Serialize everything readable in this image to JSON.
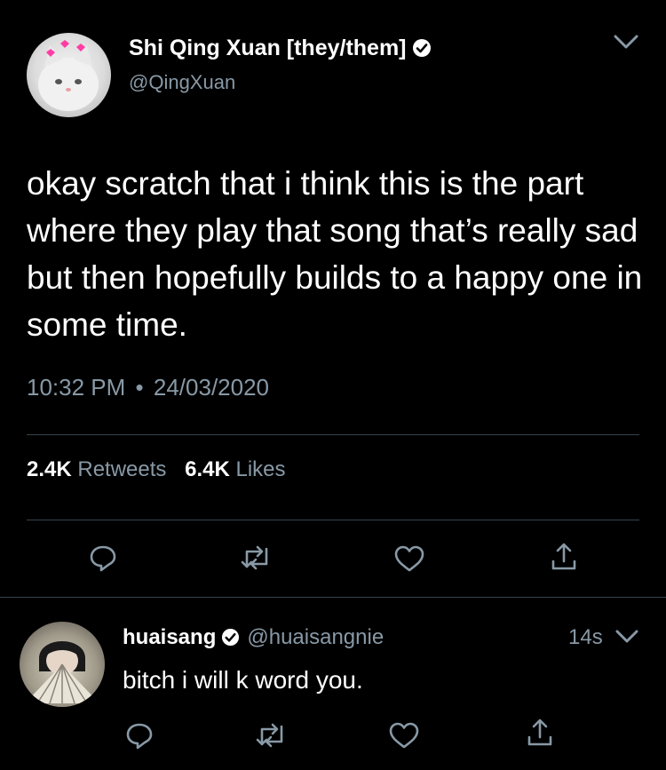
{
  "tweet": {
    "author_name": "Shi Qing Xuan [they/them]",
    "author_handle": "@QingXuan",
    "text": "okay scratch that i think this is the part where they play that song that’s really sad but then hopefully builds to a happy one in some time.",
    "time": "10:32 PM",
    "separator": "•",
    "date": "24/03/2020",
    "retweets_count": "2.4K",
    "retweets_label": "Retweets",
    "likes_count": "6.4K",
    "likes_label": "Likes"
  },
  "reply": {
    "author_name": "huaisang",
    "author_handle": "@huaisangnie",
    "time_ago": "14s",
    "text": "bitch i will k word you."
  },
  "icons": [
    "chevron-down-icon",
    "verified-icon",
    "reply-icon",
    "retweet-icon",
    "like-icon",
    "share-icon"
  ],
  "colors": {
    "background": "#000000",
    "text": "#ffffff",
    "secondary": "#8899a6",
    "divider": "#38444d"
  }
}
